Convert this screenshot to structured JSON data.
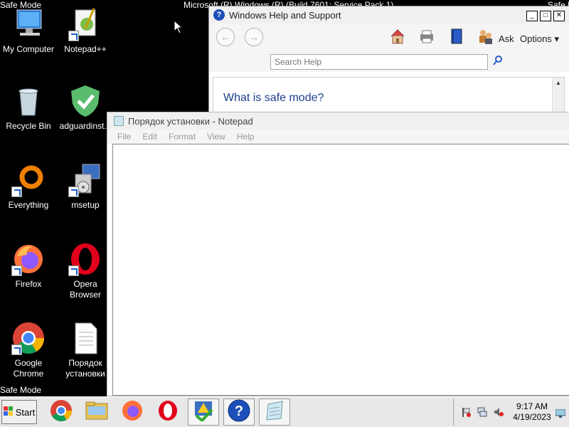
{
  "desktop": {
    "safe_mode_top_left": "Safe Mode",
    "safe_mode_bottom_left": "Safe Mode",
    "safe_mode_top_right": "Safe Mod",
    "build_text": "Microsoft (R) Windows (R) (Build 7601: Service Pack 1)",
    "icons": [
      {
        "label": "My Computer",
        "icon": "computer-icon"
      },
      {
        "label": "Notepad++",
        "icon": "notepadpp-icon"
      },
      {
        "label": "Recycle Bin",
        "icon": "recycle-bin-icon"
      },
      {
        "label": "adguardinst...",
        "icon": "adguard-shield-icon"
      },
      {
        "label": "Everything",
        "icon": "everything-icon"
      },
      {
        "label": "msetup",
        "icon": "setup-installer-icon"
      },
      {
        "label": "Firefox",
        "icon": "firefox-icon"
      },
      {
        "label": "Opera Browser",
        "icon": "opera-icon"
      },
      {
        "label": "Google Chrome",
        "icon": "chrome-icon"
      },
      {
        "label": "Порядок установки",
        "icon": "text-file-icon"
      }
    ]
  },
  "help_window": {
    "title": "Windows Help and Support",
    "ask_label": "Ask",
    "options_label": "Options",
    "search_placeholder": "Search Help",
    "heading": "What is safe mode?"
  },
  "notepad": {
    "title": "Порядок установки - Notepad",
    "menu": [
      "File",
      "Edit",
      "Format",
      "View",
      "Help"
    ],
    "content": ""
  },
  "taskbar": {
    "start_label": "Start",
    "apps": [
      "chrome-icon",
      "explorer-folder-icon",
      "firefox-icon",
      "opera-icon",
      "help-desk-icon",
      "help-icon",
      "notepad-icon"
    ],
    "time": "9:17 AM",
    "date": "4/19/2023"
  },
  "colors": {
    "desktop_bg": "#000000",
    "help_heading": "#1e3f8f",
    "taskbar_bg": "#e8e8e8"
  }
}
